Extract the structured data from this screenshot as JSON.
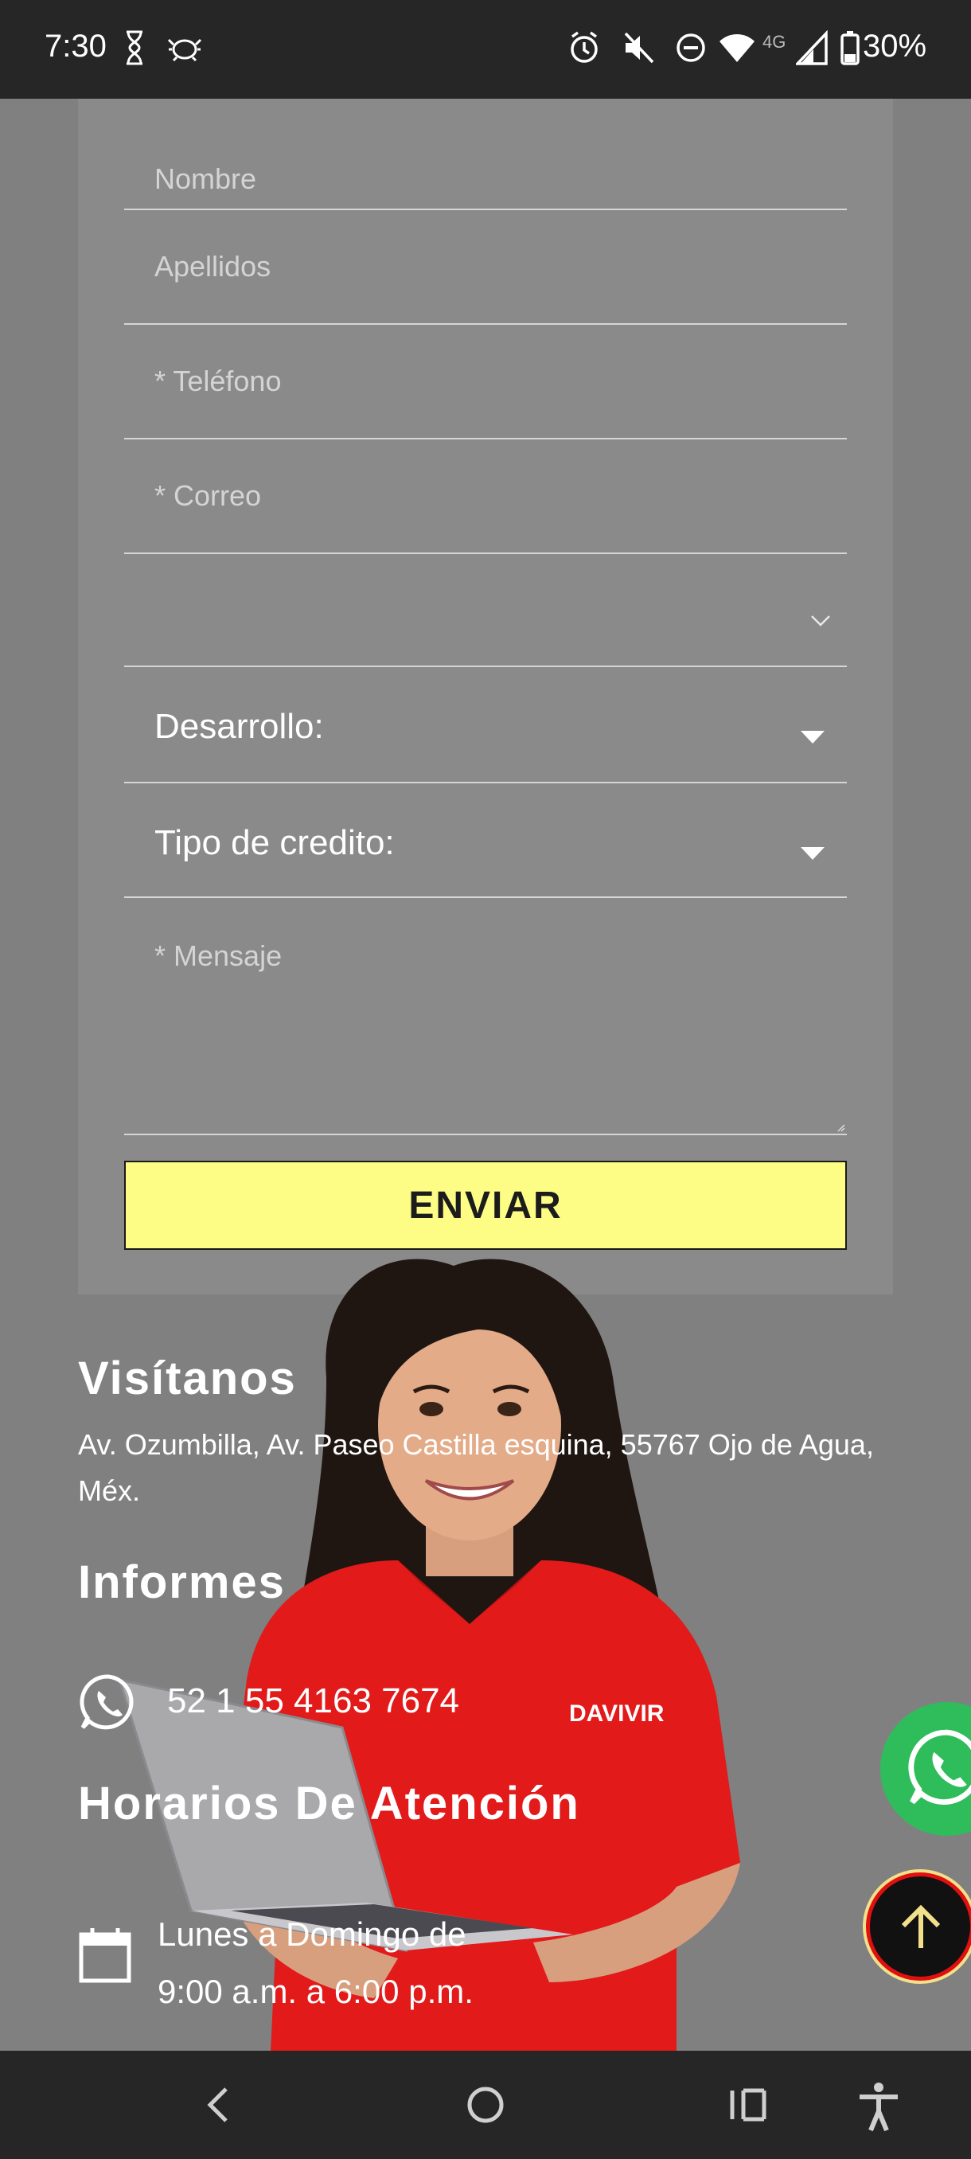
{
  "status_bar": {
    "time": "7:30",
    "network": "4G",
    "battery": "30%",
    "icons": [
      "hourglass-icon",
      "bug-icon",
      "alarm-icon",
      "mute-icon",
      "dnd-icon",
      "wifi-icon",
      "signal-icon",
      "battery-icon"
    ]
  },
  "form": {
    "name_placeholder": "Nombre",
    "lastname_placeholder": "Apellidos",
    "phone_placeholder": "* Teléfono",
    "email_placeholder": "* Correo",
    "blank_select_value": "",
    "development_label": "Desarrollo:",
    "credit_type_label": "Tipo de credito:",
    "message_placeholder": "* Mensaje",
    "submit_label": "ENVIAR"
  },
  "visit": {
    "heading": "Visítanos",
    "address_line1": "Av. Ozumbilla, Av. Paseo Castilla esquina, 55767 Ojo de Agua,",
    "address_line2": "Méx."
  },
  "info": {
    "heading": "Informes",
    "phone": "52 1 55 4163 7674"
  },
  "hours": {
    "heading": "Horarios De Atención",
    "line1": "Lunes a Domingo de",
    "line2": "9:00 a.m. a 6:00 p.m."
  },
  "shirt_logo": "DAVIVIR",
  "colors": {
    "overlay_gray": "#808080",
    "submit_yellow": "#fdfd86",
    "whatsapp_green": "#2ebd5a",
    "shirt_red": "#e21a1a"
  },
  "nav_bar": {
    "buttons": [
      "back-icon",
      "home-icon",
      "recents-icon",
      "accessibility-icon"
    ]
  }
}
